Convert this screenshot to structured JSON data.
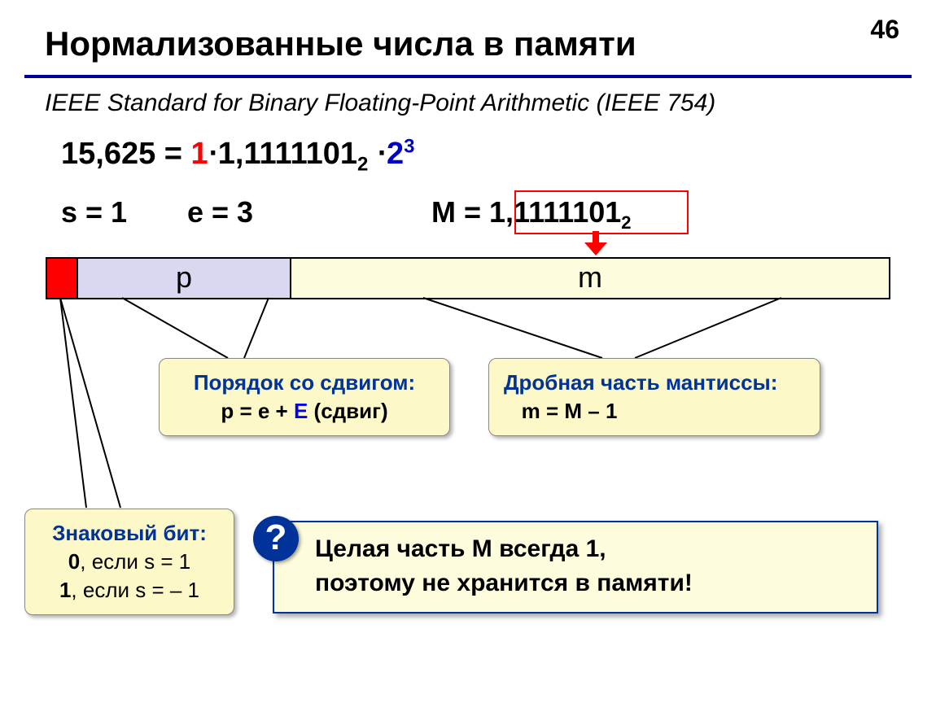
{
  "page_number": "46",
  "title": "Нормализованные числа в памяти",
  "subtitle": "IEEE Standard for Binary Floating-Point Arithmetic (IEEE 754)",
  "eq": {
    "lhs": "15,625 = ",
    "sign": "1",
    "dot1": "⋅",
    "mant": "1,1111101",
    "sub2_a": "2",
    "dot2": " ⋅",
    "base2": "2",
    "exp3": "3"
  },
  "row": {
    "s": "s = 1",
    "e": "e = 3",
    "M_pre": "M = 1,",
    "M_frac": "1111101",
    "M_sub": "2"
  },
  "bar": {
    "p": "p",
    "m": "m"
  },
  "callout_p": {
    "t": "Порядок со сдвигом:",
    "f_pre": "p = e + ",
    "f_E": "E",
    "f_post": " (сдвиг)"
  },
  "callout_m": {
    "t": "Дробная часть мантиссы:",
    "f": "m = M – 1"
  },
  "callout_s": {
    "t": "Знаковый бит:",
    "l1_b": "0",
    "l1": ", если s = 1",
    "l2_b": "1",
    "l2": ", если s = – 1"
  },
  "info": {
    "badge": "?",
    "line1": "Целая часть M всегда 1,",
    "line2": "поэтому не хранится в памяти!"
  }
}
